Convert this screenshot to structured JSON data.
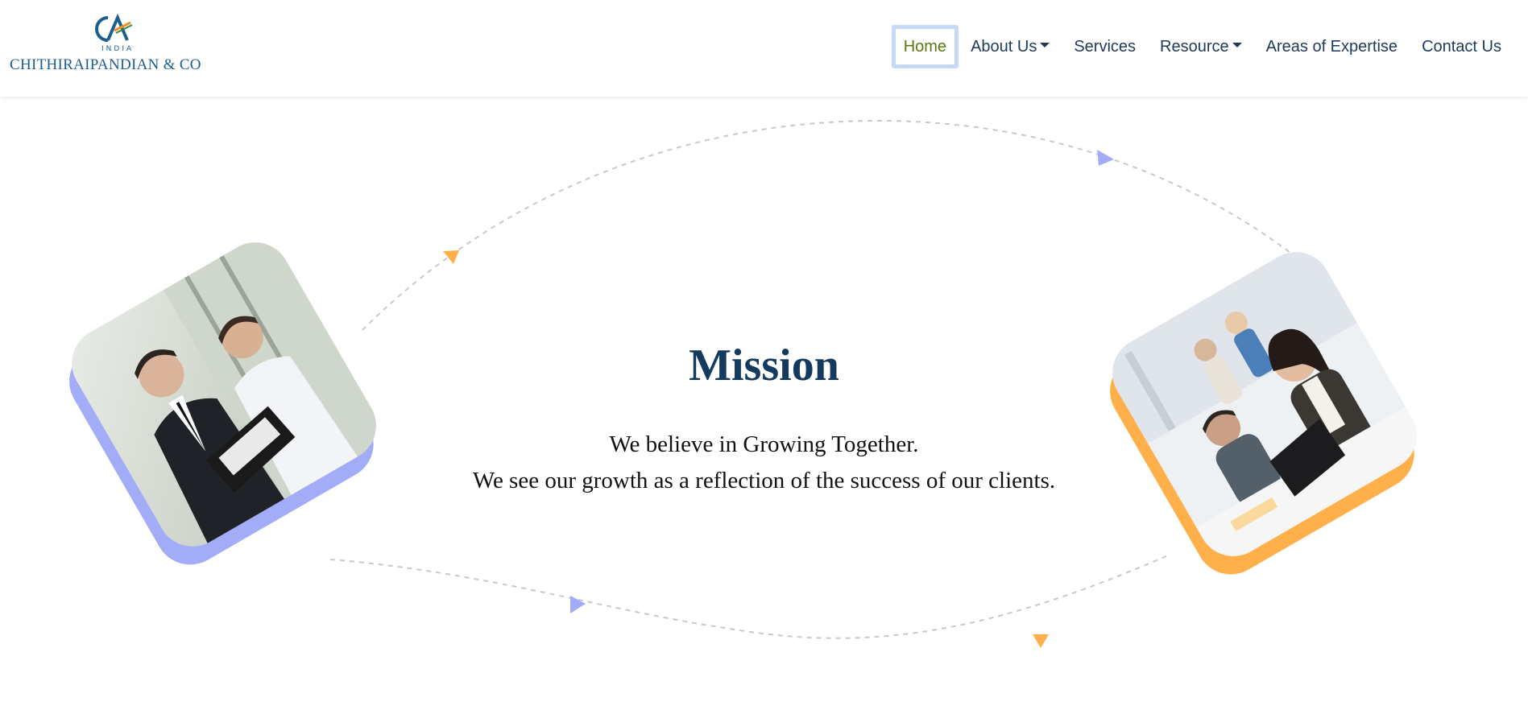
{
  "brand": {
    "logo_text": "CA",
    "logo_subtext": "INDIA",
    "name": "CHITHIRAIPANDIAN & CO"
  },
  "nav": {
    "items": [
      {
        "label": "Home",
        "active": true,
        "has_dropdown": false
      },
      {
        "label": "About Us",
        "active": false,
        "has_dropdown": true
      },
      {
        "label": "Services",
        "active": false,
        "has_dropdown": false
      },
      {
        "label": "Resource",
        "active": false,
        "has_dropdown": true
      },
      {
        "label": "Areas of Expertise",
        "active": false,
        "has_dropdown": false
      },
      {
        "label": "Contact Us",
        "active": false,
        "has_dropdown": false
      }
    ]
  },
  "mission": {
    "title": "Mission",
    "lines": [
      "We believe in Growing Together.",
      "We see our growth as a reflection of the success of our clients."
    ]
  },
  "colors": {
    "nav_text": "#1d3a5a",
    "nav_active": "#5a7a10",
    "title": "#143b5e",
    "accent_purple": "#a3acf7",
    "accent_orange": "#ffb04a",
    "brand_blue": "#1c5f8f"
  },
  "images": {
    "left": {
      "icon": "business-meeting-photo"
    },
    "right": {
      "icon": "office-team-photo"
    }
  }
}
